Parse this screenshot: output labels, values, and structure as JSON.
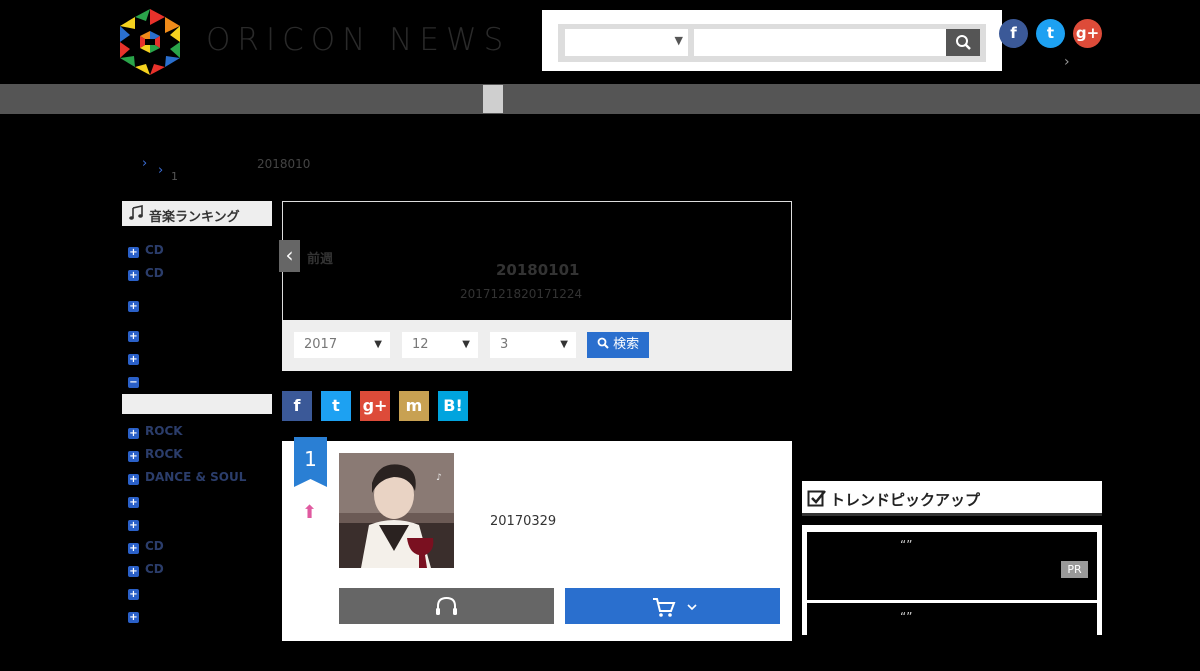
{
  "header": {
    "logo_text": "ORICON NEWS",
    "search": {
      "placeholder": "",
      "category_value": ""
    },
    "social": {
      "facebook": "f",
      "twitter": "t",
      "googleplus": "g+"
    }
  },
  "breadcrumb": {
    "num": "1",
    "date": "2018010"
  },
  "sidebar": {
    "heading": "音楽ランキング",
    "items": [
      {
        "label": "CD"
      },
      {
        "label": "CD"
      },
      {
        "label": ""
      },
      {
        "label": ""
      },
      {
        "label": ""
      },
      {
        "label": ""
      },
      {
        "label": "ROCK"
      },
      {
        "label": "ROCK"
      },
      {
        "label": "DANCE & SOUL"
      },
      {
        "label": ""
      },
      {
        "label": ""
      },
      {
        "label": "CD"
      },
      {
        "label": "CD"
      },
      {
        "label": ""
      },
      {
        "label": ""
      }
    ]
  },
  "weekly": {
    "prev_label": "前週",
    "date": "20180101",
    "range": "2017121820171224",
    "year": "2017",
    "month": "12",
    "week": "3",
    "search_label": "検索"
  },
  "share": {
    "fb": "f",
    "tw": "t",
    "gp": "g+",
    "m": "m",
    "hb": "B!"
  },
  "ranking": {
    "rank": "1",
    "release_date": "20170329"
  },
  "trend": {
    "heading": "トレンドピックアップ",
    "q1": "“”",
    "q2": "“”",
    "pr": "PR"
  },
  "colors": {
    "accent_blue": "#2a6fce",
    "rank_blue": "#2a7fd4",
    "up_arrow": "#e05aa0",
    "nav_bar": "#555555"
  }
}
